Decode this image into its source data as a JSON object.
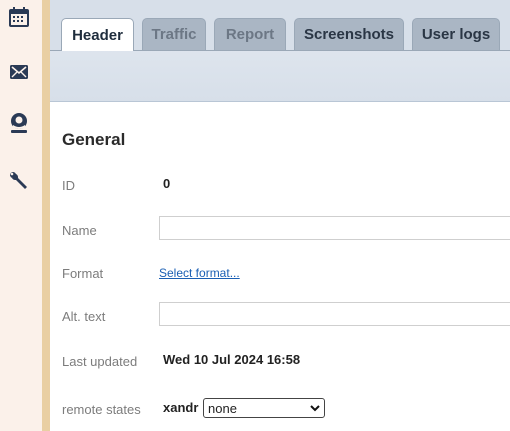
{
  "sidebar": {
    "icons": [
      "calendar-icon",
      "envelope-icon",
      "user-badge-icon",
      "wrench-icon"
    ]
  },
  "tabs": [
    {
      "label": "Header",
      "state": "active"
    },
    {
      "label": "Traffic",
      "state": "disabled"
    },
    {
      "label": "Report",
      "state": "disabled"
    },
    {
      "label": "Screenshots",
      "state": "normal"
    },
    {
      "label": "User logs",
      "state": "normal"
    }
  ],
  "section": {
    "title": "General"
  },
  "fields": {
    "id": {
      "label": "ID",
      "value": "0"
    },
    "name": {
      "label": "Name",
      "value": ""
    },
    "format": {
      "label": "Format",
      "link": "Select format..."
    },
    "alt_text": {
      "label": "Alt. text",
      "value": ""
    },
    "last_updated": {
      "label": "Last updated",
      "value": "Wed 10 Jul 2024 16:58"
    },
    "remote_states": {
      "label": "remote states",
      "provider": "xandr",
      "selected": "none"
    }
  },
  "colors": {
    "sidebar_bg": "#fbf1ea",
    "sidebar_border": "#e9cfa3",
    "icon_color": "#2a3a55",
    "link": "#1a5fb4"
  }
}
